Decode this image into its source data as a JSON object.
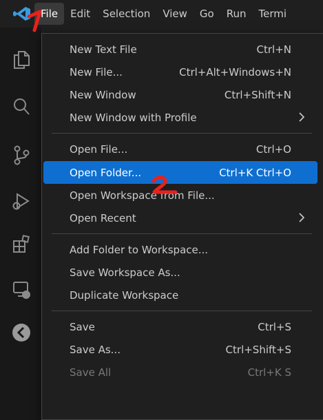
{
  "menubar": {
    "items": [
      "File",
      "Edit",
      "Selection",
      "View",
      "Go",
      "Run",
      "Termi"
    ],
    "active_index": 0
  },
  "activity_icons": [
    "files-icon",
    "search-icon",
    "source-control-icon",
    "run-debug-icon",
    "extensions-icon",
    "remote-explorer-icon",
    "accounts-icon"
  ],
  "menu": {
    "groups": [
      [
        {
          "label": "New Text File",
          "shortcut": "Ctrl+N"
        },
        {
          "label": "New File...",
          "shortcut": "Ctrl+Alt+Windows+N"
        },
        {
          "label": "New Window",
          "shortcut": "Ctrl+Shift+N"
        },
        {
          "label": "New Window with Profile",
          "shortcut": "",
          "submenu": true
        }
      ],
      [
        {
          "label": "Open File...",
          "shortcut": "Ctrl+O"
        },
        {
          "label": "Open Folder...",
          "shortcut": "Ctrl+K Ctrl+O",
          "highlight": true
        },
        {
          "label": "Open Workspace from File...",
          "shortcut": ""
        },
        {
          "label": "Open Recent",
          "shortcut": "",
          "submenu": true
        }
      ],
      [
        {
          "label": "Add Folder to Workspace...",
          "shortcut": ""
        },
        {
          "label": "Save Workspace As...",
          "shortcut": ""
        },
        {
          "label": "Duplicate Workspace",
          "shortcut": ""
        }
      ],
      [
        {
          "label": "Save",
          "shortcut": "Ctrl+S"
        },
        {
          "label": "Save As...",
          "shortcut": "Ctrl+Shift+S"
        },
        {
          "label": "Save All",
          "shortcut": "Ctrl+K S",
          "disabled": true
        }
      ]
    ]
  },
  "annotations": {
    "step1": "1",
    "step2": "2"
  },
  "colors": {
    "highlight": "#0f6fd1",
    "annotation": "#e8211c",
    "logo": "#3b9ae1"
  }
}
